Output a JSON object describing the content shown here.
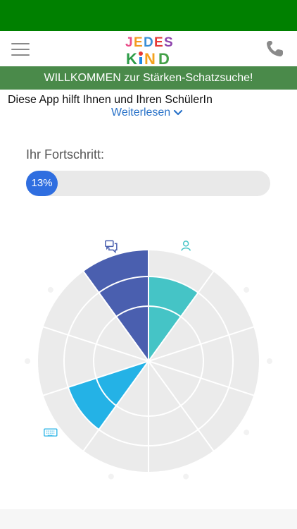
{
  "header": {
    "menu_icon": "hamburger-menu-icon",
    "logo_text": "JEDES KIND",
    "phone_icon": "phone-icon"
  },
  "banner": {
    "text": "WILLKOMMEN zur Stärken-Schatzsuche!"
  },
  "intro": {
    "text": "Diese App hilft Ihnen und Ihren SchülerIn",
    "read_more": "Weiterlesen"
  },
  "progress": {
    "label": "Ihr Fortschritt:",
    "value_text": "13%",
    "value": 0.13
  },
  "chart_data": {
    "type": "polar-area",
    "ring_count": 3,
    "categories": [
      {
        "icon": "person-icon",
        "color": "#45c4c6",
        "level": 2
      },
      {
        "icon": "category-2-icon",
        "color": "#e6e6e6",
        "level": 0
      },
      {
        "icon": "category-3-icon",
        "color": "#e6e6e6",
        "level": 0
      },
      {
        "icon": "category-4-icon",
        "color": "#e6e6e6",
        "level": 0
      },
      {
        "icon": "category-5-icon",
        "color": "#e6e6e6",
        "level": 0
      },
      {
        "icon": "category-6-icon",
        "color": "#e6e6e6",
        "level": 0
      },
      {
        "icon": "keyboard-icon",
        "color": "#24b2e6",
        "level": 2
      },
      {
        "icon": "category-8-icon",
        "color": "#e6e6e6",
        "level": 0
      },
      {
        "icon": "category-9-icon",
        "color": "#e6e6e6",
        "level": 0
      },
      {
        "icon": "chat-bubbles-icon",
        "color": "#4a5faf",
        "level": 3
      }
    ]
  }
}
